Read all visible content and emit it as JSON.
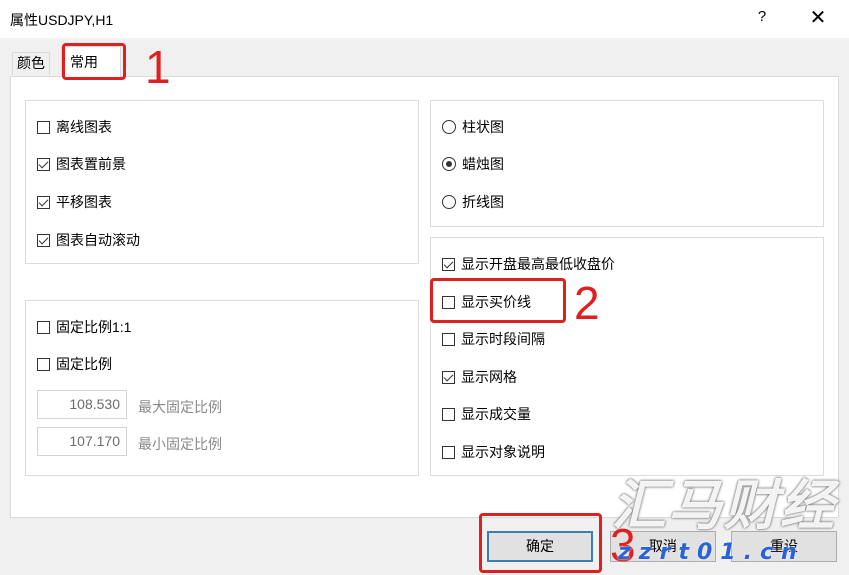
{
  "window": {
    "title": "属性USDJPY,H1",
    "help_glyph": "?",
    "close_glyph": "✕"
  },
  "tabs": [
    {
      "label": "颜色",
      "active": false
    },
    {
      "label": "常用",
      "active": true
    }
  ],
  "chart_options": [
    {
      "label": "离线图表",
      "checked": false
    },
    {
      "label": "图表置前景",
      "checked": true
    },
    {
      "label": "平移图表",
      "checked": true
    },
    {
      "label": "图表自动滚动",
      "checked": true
    }
  ],
  "chart_type": [
    {
      "label": "柱状图",
      "selected": false
    },
    {
      "label": "蜡烛图",
      "selected": true
    },
    {
      "label": "折线图",
      "selected": false
    }
  ],
  "scale": {
    "fixed_1_1": {
      "label": "固定比例1:1",
      "checked": false
    },
    "fixed": {
      "label": "固定比例",
      "checked": false
    },
    "max_value": "108.530",
    "max_label": "最大固定比例",
    "min_value": "107.170",
    "min_label": "最小固定比例"
  },
  "display_options": [
    {
      "label": "显示开盘最高最低收盘价",
      "checked": true
    },
    {
      "label": "显示买价线",
      "checked": false
    },
    {
      "label": "显示时段间隔",
      "checked": false
    },
    {
      "label": "显示网格",
      "checked": true
    },
    {
      "label": "显示成交量",
      "checked": false
    },
    {
      "label": "显示对象说明",
      "checked": false
    }
  ],
  "buttons": {
    "ok": "确定",
    "cancel": "取消",
    "reset": "重设"
  },
  "annotations": {
    "one": "1",
    "two": "2",
    "three": "3",
    "color": "#e02020"
  },
  "watermark": {
    "text": "汇马财经",
    "url": "zzrt01.cn"
  }
}
